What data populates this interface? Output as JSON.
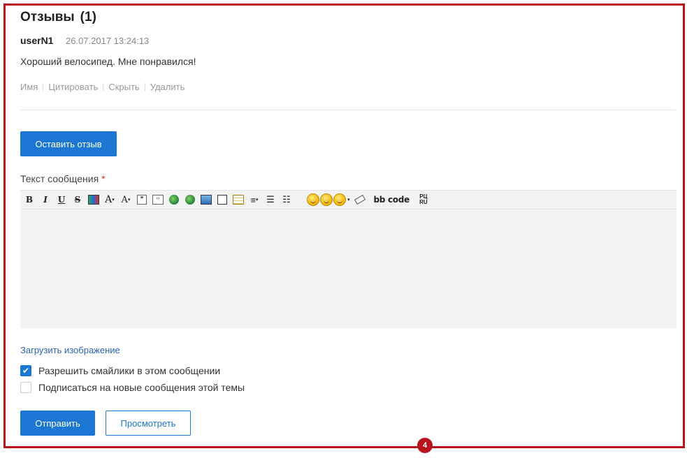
{
  "reviews": {
    "title": "Отзывы",
    "count": "(1)",
    "items": [
      {
        "author": "userN1",
        "date": "26.07.2017 13:24:13",
        "text": "Хороший велосипед. Мне понравился!",
        "actions": [
          "Имя",
          "Цитировать",
          "Скрыть",
          "Удалить"
        ]
      }
    ]
  },
  "form": {
    "leave_review_label": "Оставить отзыв",
    "message_label": "Текст сообщения",
    "required_mark": "*",
    "toolbar": {
      "bold": "B",
      "italic": "I",
      "underline": "U",
      "strike": "S",
      "font": "A",
      "size": "A",
      "bbcode": "bb code",
      "translit_top": "РЦ",
      "translit_bottom": "RU"
    },
    "upload_image_label": "Загрузить изображение",
    "allow_smiles_label": "Разрешить смайлики в этом сообщении",
    "allow_smiles_checked": true,
    "subscribe_label": "Подписаться на новые сообщения этой темы",
    "subscribe_checked": false,
    "send_label": "Отправить",
    "preview_label": "Просмотреть"
  },
  "marker": {
    "number": "4"
  },
  "colors": {
    "accent": "#1b77d3",
    "frame": "#b8141e"
  }
}
